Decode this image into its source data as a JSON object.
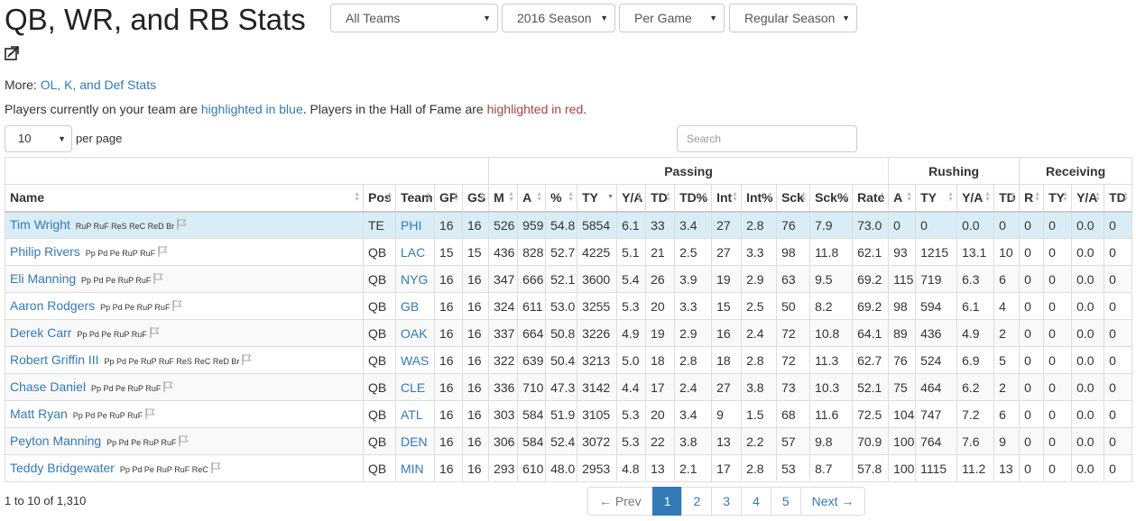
{
  "header": {
    "title": "QB, WR, and RB Stats",
    "filters": [
      {
        "label": "All Teams",
        "name": "team-filter-select"
      },
      {
        "label": "2016 Season",
        "name": "season-filter-select"
      },
      {
        "label": "Per Game",
        "name": "stat-mode-select"
      },
      {
        "label": "Regular Season",
        "name": "season-type-select"
      }
    ]
  },
  "more": {
    "prefix": "More: ",
    "link": "OL, K, and Def Stats"
  },
  "legend": {
    "text1": "Players currently on your team are ",
    "blue": "highlighted in blue",
    "text2": ". Players in the Hall of Fame are ",
    "red": "highlighted in red",
    "text3": "."
  },
  "controls": {
    "per_page": "10",
    "per_page_label": "per page",
    "search_placeholder": "Search"
  },
  "groups": {
    "passing": "Passing",
    "rushing": "Rushing",
    "receiving": "Receiving"
  },
  "columns": [
    "Name",
    "Pos",
    "Team",
    "GP",
    "GS",
    "M",
    "A",
    "%",
    "TY",
    "Y/A",
    "TD",
    "TD%",
    "Int",
    "Int%",
    "Sck",
    "Sck%",
    "Rate",
    "A",
    "TY",
    "Y/A",
    "TD",
    "R",
    "TY",
    "Y/A",
    "TD"
  ],
  "sorted_column": 8,
  "rows": [
    {
      "name": "Tim Wright",
      "badges": "RuP RuF ReS ReC ReD Br",
      "cells": [
        "TE",
        "PHI",
        "16",
        "16",
        "526",
        "959",
        "54.8",
        "5854",
        "6.1",
        "33",
        "3.4",
        "27",
        "2.8",
        "76",
        "7.9",
        "73.0",
        "0",
        "0",
        "0.0",
        "0",
        "0",
        "0",
        "0.0",
        "0"
      ]
    },
    {
      "name": "Philip Rivers",
      "badges": "Pp Pd Pe RuP RuF",
      "cells": [
        "QB",
        "LAC",
        "15",
        "15",
        "436",
        "828",
        "52.7",
        "4225",
        "5.1",
        "21",
        "2.5",
        "27",
        "3.3",
        "98",
        "11.8",
        "62.1",
        "93",
        "1215",
        "13.1",
        "10",
        "0",
        "0",
        "0.0",
        "0"
      ]
    },
    {
      "name": "Eli Manning",
      "badges": "Pp Pd Pe RuP RuF",
      "cells": [
        "QB",
        "NYG",
        "16",
        "16",
        "347",
        "666",
        "52.1",
        "3600",
        "5.4",
        "26",
        "3.9",
        "19",
        "2.9",
        "63",
        "9.5",
        "69.2",
        "115",
        "719",
        "6.3",
        "6",
        "0",
        "0",
        "0.0",
        "0"
      ]
    },
    {
      "name": "Aaron Rodgers",
      "badges": "Pp Pd Pe RuP RuF",
      "cells": [
        "QB",
        "GB",
        "16",
        "16",
        "324",
        "611",
        "53.0",
        "3255",
        "5.3",
        "20",
        "3.3",
        "15",
        "2.5",
        "50",
        "8.2",
        "69.2",
        "98",
        "594",
        "6.1",
        "4",
        "0",
        "0",
        "0.0",
        "0"
      ]
    },
    {
      "name": "Derek Carr",
      "badges": "Pp Pd Pe RuP RuF",
      "cells": [
        "QB",
        "OAK",
        "16",
        "16",
        "337",
        "664",
        "50.8",
        "3226",
        "4.9",
        "19",
        "2.9",
        "16",
        "2.4",
        "72",
        "10.8",
        "64.1",
        "89",
        "436",
        "4.9",
        "2",
        "0",
        "0",
        "0.0",
        "0"
      ]
    },
    {
      "name": "Robert Griffin III",
      "badges": "Pp Pd Pe RuP RuF ReS ReC ReD Br",
      "cells": [
        "QB",
        "WAS",
        "16",
        "16",
        "322",
        "639",
        "50.4",
        "3213",
        "5.0",
        "18",
        "2.8",
        "18",
        "2.8",
        "72",
        "11.3",
        "62.7",
        "76",
        "524",
        "6.9",
        "5",
        "0",
        "0",
        "0.0",
        "0"
      ]
    },
    {
      "name": "Chase Daniel",
      "badges": "Pp Pd Pe RuP RuF",
      "cells": [
        "QB",
        "CLE",
        "16",
        "16",
        "336",
        "710",
        "47.3",
        "3142",
        "4.4",
        "17",
        "2.4",
        "27",
        "3.8",
        "73",
        "10.3",
        "52.1",
        "75",
        "464",
        "6.2",
        "2",
        "0",
        "0",
        "0.0",
        "0"
      ]
    },
    {
      "name": "Matt Ryan",
      "badges": "Pp Pd Pe RuP RuF",
      "cells": [
        "QB",
        "ATL",
        "16",
        "16",
        "303",
        "584",
        "51.9",
        "3105",
        "5.3",
        "20",
        "3.4",
        "9",
        "1.5",
        "68",
        "11.6",
        "72.5",
        "104",
        "747",
        "7.2",
        "6",
        "0",
        "0",
        "0.0",
        "0"
      ]
    },
    {
      "name": "Peyton Manning",
      "badges": "Pp Pd Pe RuP RuF",
      "cells": [
        "QB",
        "DEN",
        "16",
        "16",
        "306",
        "584",
        "52.4",
        "3072",
        "5.3",
        "22",
        "3.8",
        "13",
        "2.2",
        "57",
        "9.8",
        "70.9",
        "100",
        "764",
        "7.6",
        "9",
        "0",
        "0",
        "0.0",
        "0"
      ]
    },
    {
      "name": "Teddy Bridgewater",
      "badges": "Pp Pd Pe RuP RuF ReC",
      "cells": [
        "QB",
        "MIN",
        "16",
        "16",
        "293",
        "610",
        "48.0",
        "2953",
        "4.8",
        "13",
        "2.1",
        "17",
        "2.8",
        "53",
        "8.7",
        "57.8",
        "100",
        "1115",
        "11.2",
        "13",
        "0",
        "0",
        "0.0",
        "0"
      ]
    }
  ],
  "footer": {
    "count": "1 to 10 of 1,310"
  },
  "pagination": [
    "← Prev",
    "1",
    "2",
    "3",
    "4",
    "5",
    "Next →"
  ],
  "pagination_active": "1",
  "colors": {
    "link": "#337ab7",
    "highlight_row": "#d9edf7",
    "hof_red": "#a94442"
  }
}
